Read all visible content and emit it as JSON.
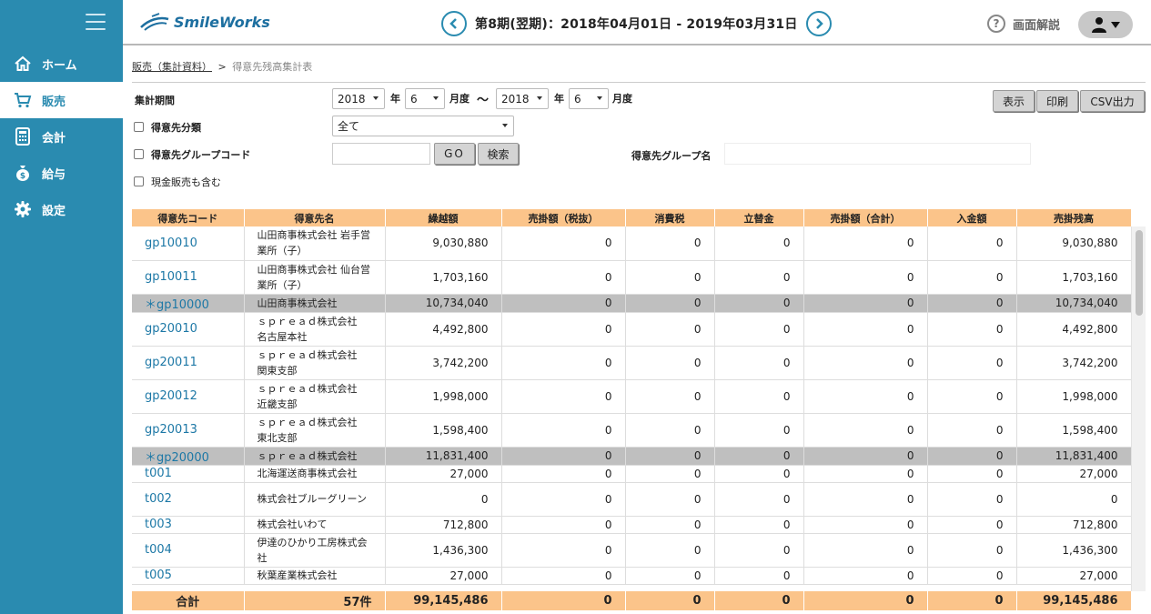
{
  "header": {
    "logo_text": "SmileWorks",
    "period": "第8期(翌期)：2018年04月01日 - 2019年03月31日",
    "help_label": "画面解説"
  },
  "sidebar": {
    "items": [
      {
        "label": "ホーム",
        "icon": "home-icon"
      },
      {
        "label": "販売",
        "icon": "cart-icon",
        "active": true
      },
      {
        "label": "会計",
        "icon": "calculator-icon"
      },
      {
        "label": "給与",
        "icon": "money-bag-icon"
      },
      {
        "label": "設定",
        "icon": "gear-icon"
      }
    ]
  },
  "breadcrumb": {
    "parent": "販売（集計資料）",
    "separator": ">",
    "current": "得意先残高集計表"
  },
  "form": {
    "period_label": "集計期間",
    "from_year": "2018",
    "year_unit": "年",
    "from_month": "6",
    "month_unit": "月度",
    "tilde": "〜",
    "to_year": "2018",
    "to_month": "6",
    "customer_class_label": "得意先分類",
    "customer_class_value": "全て",
    "group_code_label": "得意先グループコード",
    "group_code_value": "",
    "go_label": "GO",
    "search_label": "検索",
    "group_name_label": "得意先グループ名",
    "group_name_value": "",
    "cash_sales_label": "現金販売も含む",
    "display_label": "表示",
    "print_label": "印刷",
    "csv_label": "CSV出力"
  },
  "table": {
    "columns": [
      "得意先コード",
      "得意先名",
      "繰越額",
      "売掛額（税抜）",
      "消費税",
      "立替金",
      "売掛額（合計）",
      "入金額",
      "売掛残高"
    ],
    "rows": [
      {
        "code": "gp10010",
        "name": "山田商事株式会社 岩手営業所（子）",
        "values": [
          "9,030,880",
          "0",
          "0",
          "0",
          "0",
          "0",
          "9,030,880"
        ],
        "summary": false
      },
      {
        "code": "gp10011",
        "name": "山田商事株式会社 仙台営業所（子）",
        "values": [
          "1,703,160",
          "0",
          "0",
          "0",
          "0",
          "0",
          "1,703,160"
        ],
        "summary": false
      },
      {
        "code": "＊gp10000",
        "name": "山田商事株式会社",
        "values": [
          "10,734,040",
          "0",
          "0",
          "0",
          "0",
          "0",
          "10,734,040"
        ],
        "summary": true
      },
      {
        "code": "gp20010",
        "name": "ｓｐｒｅａｄ株式会社　名古屋本社",
        "values": [
          "4,492,800",
          "0",
          "0",
          "0",
          "0",
          "0",
          "4,492,800"
        ],
        "summary": false
      },
      {
        "code": "gp20011",
        "name": "ｓｐｒｅａｄ株式会社　関東支部",
        "values": [
          "3,742,200",
          "0",
          "0",
          "0",
          "0",
          "0",
          "3,742,200"
        ],
        "summary": false
      },
      {
        "code": "gp20012",
        "name": "ｓｐｒｅａｄ株式会社　近畿支部",
        "values": [
          "1,998,000",
          "0",
          "0",
          "0",
          "0",
          "0",
          "1,998,000"
        ],
        "summary": false
      },
      {
        "code": "gp20013",
        "name": "ｓｐｒｅａｄ株式会社　東北支部",
        "values": [
          "1,598,400",
          "0",
          "0",
          "0",
          "0",
          "0",
          "1,598,400"
        ],
        "summary": false
      },
      {
        "code": "＊gp20000",
        "name": "ｓｐｒｅａｄ株式会社",
        "values": [
          "11,831,400",
          "0",
          "0",
          "0",
          "0",
          "0",
          "11,831,400"
        ],
        "summary": true
      },
      {
        "code": "t001",
        "name": "北海運送商事株式会社",
        "values": [
          "27,000",
          "0",
          "0",
          "0",
          "0",
          "0",
          "27,000"
        ],
        "summary": false
      },
      {
        "code": "t002",
        "name": "株式会社ブルーグリーン",
        "values": [
          "0",
          "0",
          "0",
          "0",
          "0",
          "0",
          "0"
        ],
        "summary": false
      },
      {
        "code": "t003",
        "name": "株式会社いわて",
        "values": [
          "712,800",
          "0",
          "0",
          "0",
          "0",
          "0",
          "712,800"
        ],
        "summary": false
      },
      {
        "code": "t004",
        "name": "伊達のひかり工房株式会社",
        "values": [
          "1,436,300",
          "0",
          "0",
          "0",
          "0",
          "0",
          "1,436,300"
        ],
        "summary": false
      },
      {
        "code": "t005",
        "name": "秋葉産業株式会社",
        "values": [
          "27,000",
          "0",
          "0",
          "0",
          "0",
          "0",
          "27,000"
        ],
        "summary": false
      }
    ],
    "total": {
      "label": "合計",
      "count": "57件",
      "values": [
        "99,145,486",
        "0",
        "0",
        "0",
        "0",
        "0",
        "99,145,486"
      ]
    }
  },
  "colors": {
    "sidebar": "#2a8bb0",
    "table_header": "#fbc48a",
    "summary_row": "#bfbfbf",
    "link": "#1d78a6"
  }
}
